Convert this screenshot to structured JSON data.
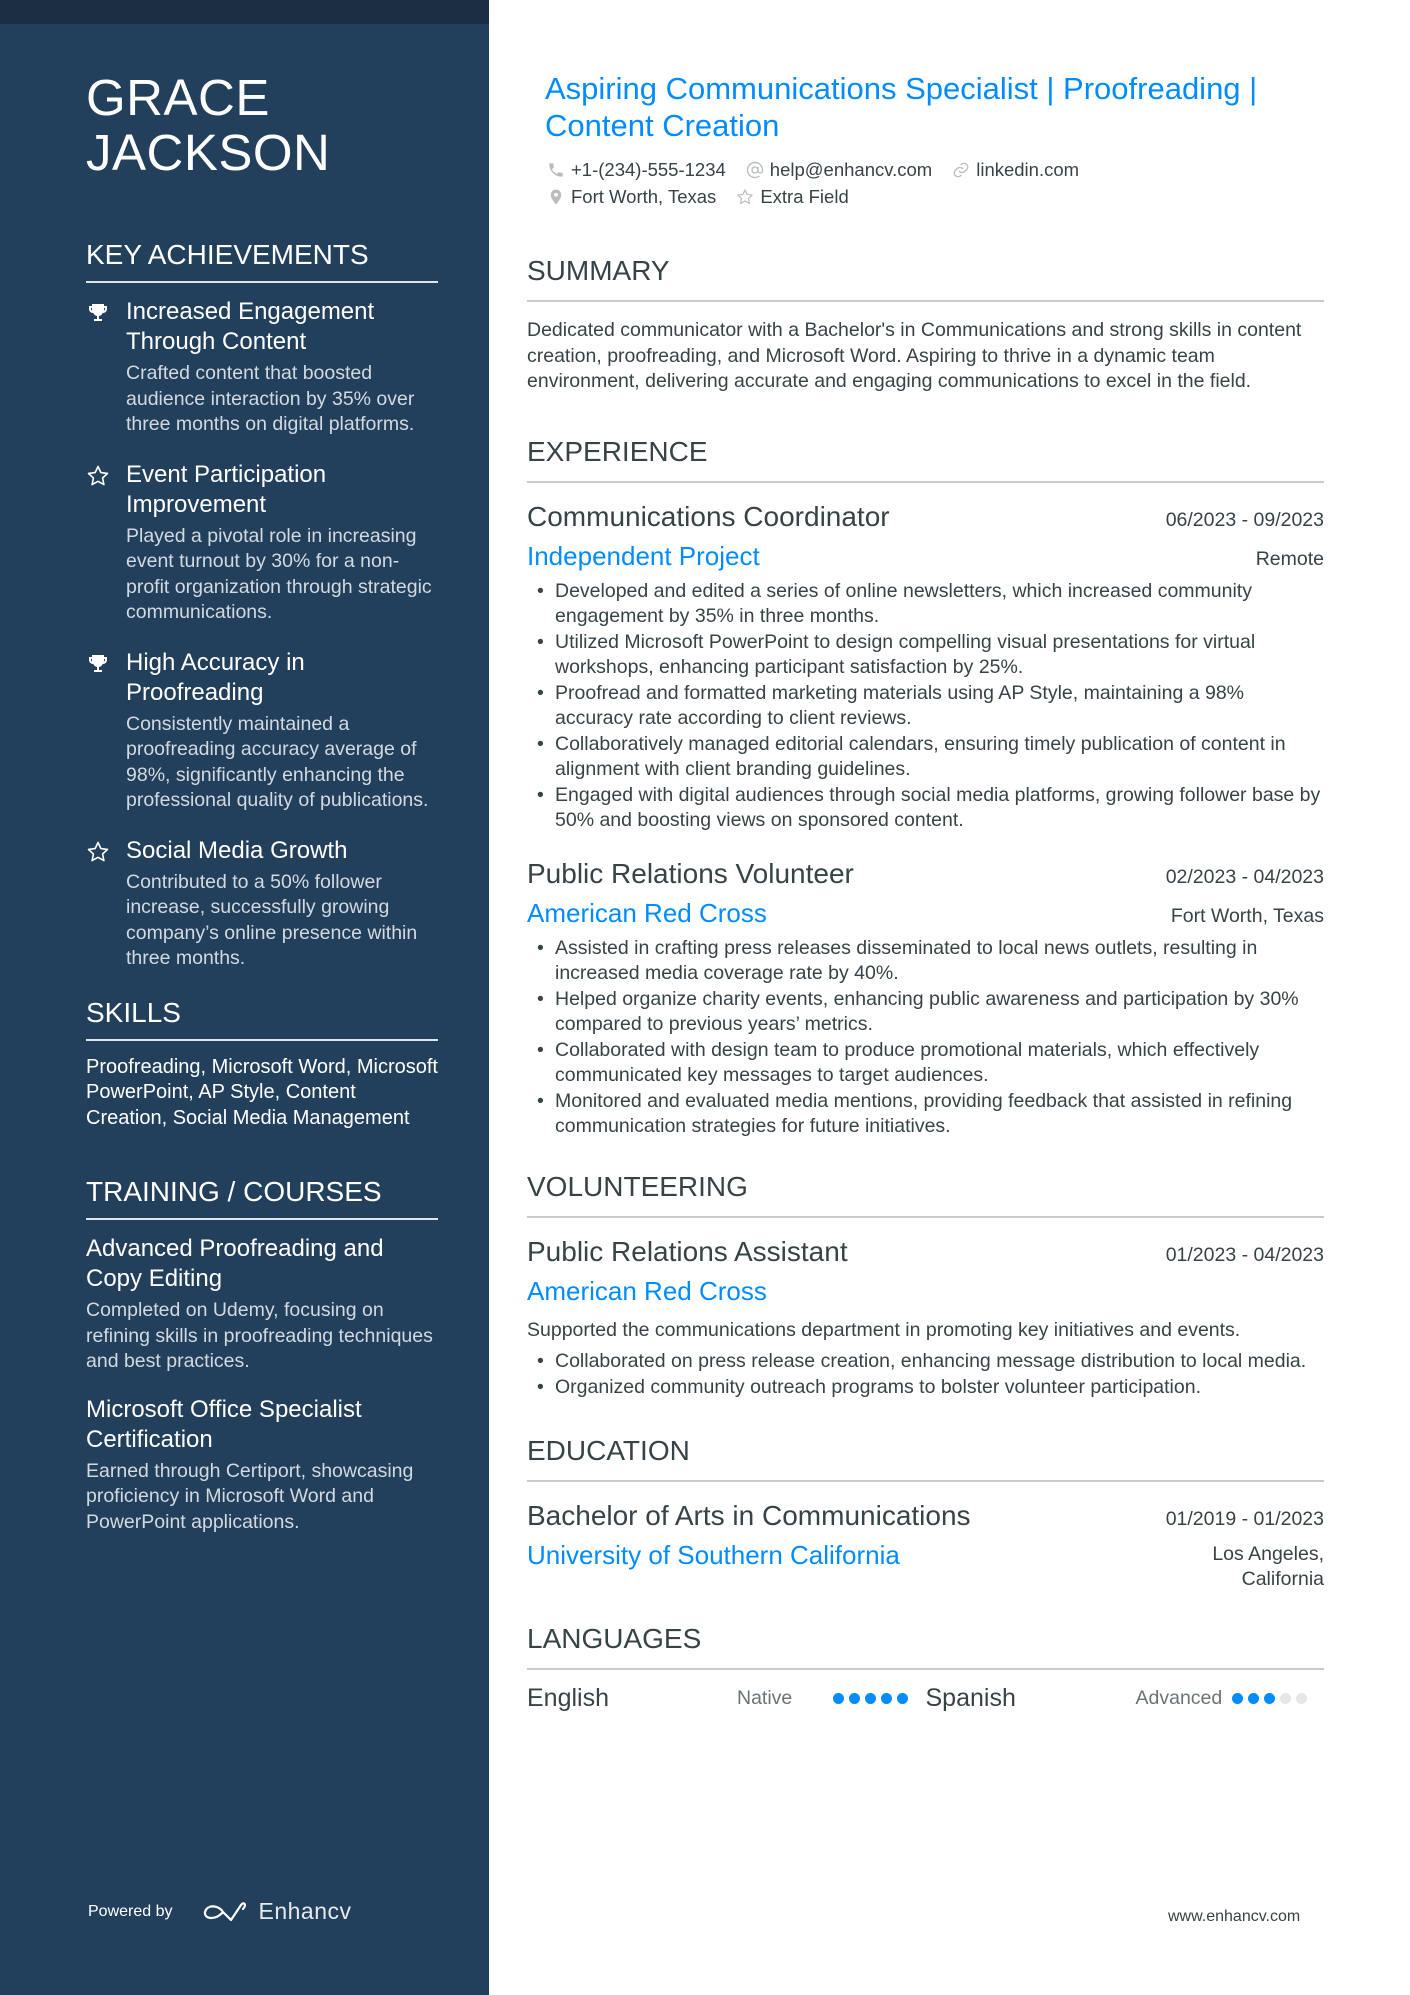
{
  "colors": {
    "sidebar": "#22405c",
    "sidebar_band": "#1a2d42",
    "accent": "#008cff",
    "text": "#384347"
  },
  "name": "GRACE JACKSON",
  "headline": "Aspiring Communications Specialist | Proofreading | Content Creation",
  "contacts": [
    {
      "icon": "phone-icon",
      "text": "+1-(234)-555-1234"
    },
    {
      "icon": "at-icon",
      "text": "help@enhancv.com"
    },
    {
      "icon": "link-icon",
      "text": "linkedin.com"
    },
    {
      "icon": "location-icon",
      "text": "Fort Worth, Texas"
    },
    {
      "icon": "star-icon",
      "text": "Extra Field"
    }
  ],
  "sidebar": {
    "achievements": {
      "title": "KEY ACHIEVEMENTS",
      "items": [
        {
          "icon": "trophy-icon",
          "title": "Increased Engagement Through Content",
          "desc": "Crafted content that boosted audience interaction by 35% over three months on digital platforms."
        },
        {
          "icon": "star-icon",
          "title": "Event Participation Improvement",
          "desc": "Played a pivotal role in increasing event turnout by 30% for a non-profit organization through strategic communications."
        },
        {
          "icon": "trophy-icon",
          "title": "High Accuracy in Proofreading",
          "desc": "Consistently maintained a proofreading accuracy average of 98%, significantly enhancing the professional quality of publications."
        },
        {
          "icon": "star-icon",
          "title": "Social Media Growth",
          "desc": "Contributed to a 50% follower increase, successfully growing company’s online presence within three months."
        }
      ]
    },
    "skills": {
      "title": "SKILLS",
      "text": "Proofreading, Microsoft Word, Microsoft PowerPoint, AP Style, Content Creation, Social Media Management"
    },
    "training": {
      "title": "TRAINING / COURSES",
      "items": [
        {
          "title": "Advanced Proofreading and Copy Editing",
          "desc": "Completed on Udemy, focusing on refining skills in proofreading techniques and best practices."
        },
        {
          "title": "Microsoft Office Specialist Certification",
          "desc": "Earned through Certiport, showcasing proficiency in Microsoft Word and PowerPoint applications."
        }
      ]
    },
    "powered_by": "Powered by",
    "brand": "Enhancv"
  },
  "summary": {
    "title": "SUMMARY",
    "text": "Dedicated communicator with a Bachelor's in Communications and strong skills in content creation, proofreading, and Microsoft Word. Aspiring to thrive in a dynamic team environment, delivering accurate and engaging communications to excel in the field."
  },
  "experience": {
    "title": "EXPERIENCE",
    "items": [
      {
        "role": "Communications Coordinator",
        "dates": "06/2023 - 09/2023",
        "org": "Independent Project",
        "location": "Remote",
        "bullets": [
          "Developed and edited a series of online newsletters, which increased community engagement by 35% in three months.",
          "Utilized Microsoft PowerPoint to design compelling visual presentations for virtual workshops, enhancing participant satisfaction by 25%.",
          "Proofread and formatted marketing materials using AP Style, maintaining a 98% accuracy rate according to client reviews.",
          "Collaboratively managed editorial calendars, ensuring timely publication of content in alignment with client branding guidelines.",
          "Engaged with digital audiences through social media platforms, growing follower base by 50% and boosting views on sponsored content."
        ]
      },
      {
        "role": "Public Relations Volunteer",
        "dates": "02/2023 - 04/2023",
        "org": "American Red Cross",
        "location": "Fort Worth, Texas",
        "bullets": [
          "Assisted in crafting press releases disseminated to local news outlets, resulting in increased media coverage rate by 40%.",
          "Helped organize charity events, enhancing public awareness and participation by 30% compared to previous years’ metrics.",
          "Collaborated with design team to produce promotional materials, which effectively communicated key messages to target audiences.",
          "Monitored and evaluated media mentions, providing feedback that assisted in refining communication strategies for future initiatives."
        ]
      }
    ]
  },
  "volunteering": {
    "title": "VOLUNTEERING",
    "items": [
      {
        "role": "Public Relations Assistant",
        "dates": "01/2023 - 04/2023",
        "org": "American Red Cross",
        "desc": "Supported the communications department in promoting key initiatives and events.",
        "bullets": [
          "Collaborated on press release creation, enhancing message distribution to local media.",
          "Organized community outreach programs to bolster volunteer participation."
        ]
      }
    ]
  },
  "education": {
    "title": "EDUCATION",
    "items": [
      {
        "degree": "Bachelor of Arts in Communications",
        "dates": "01/2019 - 01/2023",
        "school": "University of Southern California",
        "location_line1": "Los Angeles,",
        "location_line2": "California"
      }
    ]
  },
  "languages": {
    "title": "LANGUAGES",
    "items": [
      {
        "name": "English",
        "level": "Native",
        "rating": 5,
        "max": 5
      },
      {
        "name": "Spanish",
        "level": "Advanced",
        "rating": 3,
        "max": 5
      }
    ]
  },
  "footer": {
    "site": "www.enhancv.com"
  }
}
